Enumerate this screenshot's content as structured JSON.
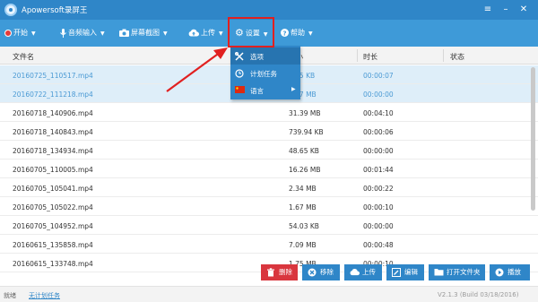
{
  "window": {
    "title": "Apowersoft录屏王"
  },
  "toolbar": {
    "start": "开始",
    "audio_input": "音频输入",
    "screenshot": "屏幕截图",
    "upload": "上传",
    "settings": "设置",
    "help": "帮助"
  },
  "table": {
    "columns": [
      "文件名",
      "大小",
      "时长",
      "状态"
    ],
    "rows": [
      {
        "name": "20160725_110517.mp4",
        "size": "1.35 KB",
        "duration": "00:00:07",
        "status": "",
        "selected": true
      },
      {
        "name": "20160722_111218.mp4",
        "size": "1.57 MB",
        "duration": "00:00:00",
        "status": "",
        "selected": true
      },
      {
        "name": "20160718_140906.mp4",
        "size": "31.39 MB",
        "duration": "00:04:10",
        "status": ""
      },
      {
        "name": "20160718_140843.mp4",
        "size": "739.94 KB",
        "duration": "00:00:06",
        "status": ""
      },
      {
        "name": "20160718_134934.mp4",
        "size": "48.65 KB",
        "duration": "00:00:00",
        "status": ""
      },
      {
        "name": "20160705_110005.mp4",
        "size": "16.26 MB",
        "duration": "00:01:44",
        "status": ""
      },
      {
        "name": "20160705_105041.mp4",
        "size": "2.34 MB",
        "duration": "00:00:22",
        "status": ""
      },
      {
        "name": "20160705_105022.mp4",
        "size": "1.67 MB",
        "duration": "00:00:10",
        "status": ""
      },
      {
        "name": "20160705_104952.mp4",
        "size": "54.03 KB",
        "duration": "00:00:00",
        "status": ""
      },
      {
        "name": "20160615_135858.mp4",
        "size": "7.09 MB",
        "duration": "00:00:48",
        "status": ""
      },
      {
        "name": "20160615_133748.mp4",
        "size": "1.75 MB",
        "duration": "00:00:10",
        "status": ""
      }
    ]
  },
  "settings_menu": {
    "items": [
      {
        "label": "选项",
        "icon": "tools-icon"
      },
      {
        "label": "计划任务",
        "icon": "clock-icon"
      },
      {
        "label": "语言",
        "icon": "flag-icon"
      }
    ]
  },
  "actions": {
    "delete": "删除",
    "remove": "移除",
    "upload": "上传",
    "edit": "编辑",
    "open_folder": "打开文件夹",
    "play": "播放"
  },
  "status": {
    "ready": "就绪",
    "no_task": "无计划任务",
    "version": "V2.1.3 (Build 03/18/2016)"
  },
  "colors": {
    "titlebar": "#2f86c8",
    "toolbar": "#3e9ad8",
    "highlight": "#e12020",
    "delete": "#d9363e",
    "action_blue": "#2f86c8",
    "selected_row": "#deeef9"
  }
}
